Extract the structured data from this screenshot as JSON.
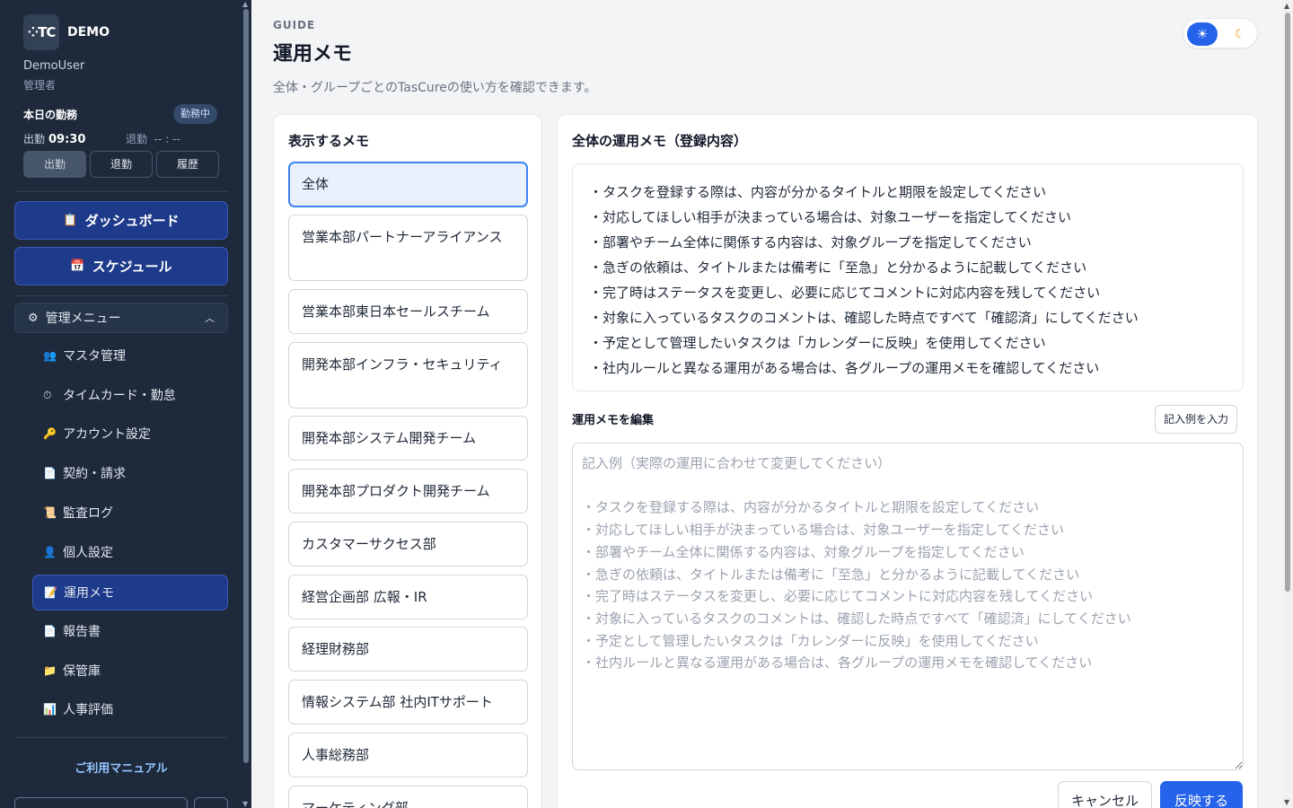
{
  "sidebar": {
    "logo_text": "⁘TC",
    "brand": "DEMO",
    "user_name": "DemoUser",
    "user_role": "管理者",
    "attendance": {
      "title": "本日の勤務",
      "status": "勤務中",
      "in_label": "出勤",
      "in_time": "09:30",
      "out_label": "退勤",
      "out_time": "-- : --",
      "buttons": [
        "出勤",
        "退勤",
        "履歴"
      ]
    },
    "dashboard_label": "ダッシュボード",
    "schedule_label": "スケジュール",
    "admin_menu_label": "管理メニュー",
    "items": [
      {
        "label": "マスタ管理",
        "icon": "👥"
      },
      {
        "label": "タイムカード・勤怠",
        "icon": "⏱"
      },
      {
        "label": "アカウント設定",
        "icon": "🔑"
      },
      {
        "label": "契約・請求",
        "icon": "📄"
      },
      {
        "label": "監査ログ",
        "icon": "📜"
      },
      {
        "label": "個人設定",
        "icon": "👤"
      },
      {
        "label": "運用メモ",
        "icon": "📝"
      },
      {
        "label": "報告書",
        "icon": "📄"
      },
      {
        "label": "保管庫",
        "icon": "📁"
      },
      {
        "label": "人事評価",
        "icon": "📊"
      }
    ],
    "manual_link": "ご利用マニュアル"
  },
  "header": {
    "kicker": "GUIDE",
    "title": "運用メモ",
    "subtitle": "全体・グループごとのTasCureの使い方を確認できます。"
  },
  "theme_toggle": {
    "light_icon": "☀",
    "dark_icon": "☾"
  },
  "memo_list": {
    "title": "表示するメモ",
    "items": [
      "全体",
      "営業本部パートナーアライアンス",
      "営業本部東日本セールスチーム",
      "開発本部インフラ・セキュリティ",
      "開発本部システム開発チーム",
      "開発本部プロダクト開発チーム",
      "カスタマーサクセス部",
      "経営企画部 広報・IR",
      "経理財務部",
      "情報システム部 社内ITサポート",
      "人事総務部",
      "マーケティング部"
    ]
  },
  "memo_detail": {
    "title": "全体の運用メモ（登録内容）",
    "lines": [
      "・タスクを登録する際は、内容が分かるタイトルと期限を設定してください",
      "・対応してほしい相手が決まっている場合は、対象ユーザーを指定してください",
      "・部署やチーム全体に関係する内容は、対象グループを指定してください",
      "・急ぎの依頼は、タイトルまたは備考に「至急」と分かるように記載してください",
      "・完了時はステータスを変更し、必要に応じてコメントに対応内容を残してください",
      "・対象に入っているタスクのコメントは、確認した時点ですべて「確認済」にしてください",
      "・予定として管理したいタスクは「カレンダーに反映」を使用してください",
      "・社内ルールと異なる運用がある場合は、各グループの運用メモを確認してください"
    ],
    "edit_label": "運用メモを編集",
    "sample_button": "記入例を入力",
    "textarea_value": "",
    "textarea_placeholder": "記入例（実際の運用に合わせて変更してください）\n\n・タスクを登録する際は、内容が分かるタイトルと期限を設定してください\n・対応してほしい相手が決まっている場合は、対象ユーザーを指定してください\n・部署やチーム全体に関係する内容は、対象グループを指定してください\n・急ぎの依頼は、タイトルまたは備考に「至急」と分かるように記載してください\n・完了時はステータスを変更し、必要に応じてコメントに対応内容を残してください\n・対象に入っているタスクのコメントは、確認した時点ですべて「確認済」にしてください\n・予定として管理したいタスクは「カレンダーに反映」を使用してください\n・社内ルールと異なる運用がある場合は、各グループの運用メモを確認してください",
    "cancel_button": "キャンセル",
    "submit_button": "反映する"
  }
}
